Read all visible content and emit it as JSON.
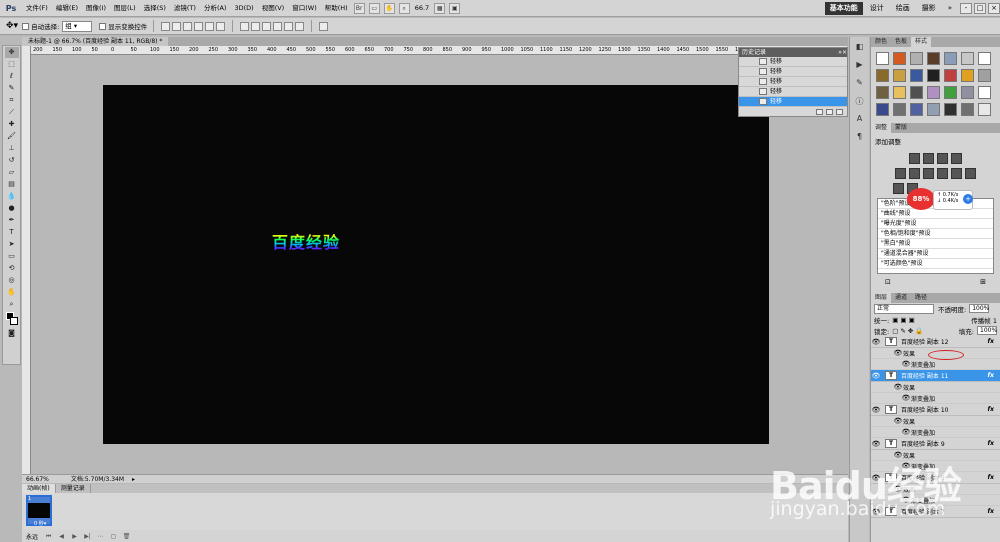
{
  "menubar": {
    "logo": "Ps",
    "items": [
      "文件(F)",
      "编辑(E)",
      "图像(I)",
      "图层(L)",
      "选择(S)",
      "滤镜(T)",
      "分析(A)",
      "3D(D)",
      "视图(V)",
      "窗口(W)",
      "帮助(H)"
    ],
    "zoom": "66.7",
    "workspaces": [
      "基本功能",
      "设计",
      "绘画",
      "摄影"
    ],
    "active_workspace": "基本功能",
    "window_controls": [
      "-",
      "□",
      "×"
    ]
  },
  "options": {
    "auto_select_label": "自动选择:",
    "auto_select_value": "组",
    "show_transform_label": "显示变换控件"
  },
  "document": {
    "tab_title": "未标题-1 @ 66.7% (百度经验 副本 11, RGB/8) *",
    "ruler_marks": [
      "200",
      "150",
      "100",
      "50",
      "0",
      "50",
      "100",
      "150",
      "200",
      "250",
      "300",
      "350",
      "400",
      "450",
      "500",
      "550",
      "600",
      "650",
      "700",
      "750",
      "800",
      "850",
      "900",
      "950",
      "1000",
      "1050",
      "1100",
      "1150",
      "1200",
      "1250",
      "1300",
      "1350",
      "1400",
      "1450",
      "1500",
      "1550",
      "1600",
      "1650",
      "1700",
      "1750",
      "1800"
    ],
    "canvas_text": "百度经验",
    "status_zoom": "66.67%",
    "status_doc": "文档:5.70M/3.34M"
  },
  "timeline": {
    "tabs": [
      "动画(帧)",
      "测量记录"
    ],
    "frame_number": "1",
    "frame_time": "0 秒▾",
    "loop": "永远"
  },
  "history": {
    "title": "历史记录",
    "items": [
      "轻移",
      "轻移",
      "轻移",
      "轻移",
      "轻移"
    ],
    "selected_index": 4
  },
  "styles_panel": {
    "tabs": [
      "颜色",
      "色板",
      "样式"
    ],
    "active_tab": "样式",
    "swatches": [
      "#ffffff",
      "#d45a1f",
      "#b0b0b0",
      "#5a3e2a",
      "#8a9cb8",
      "#c7c7c7",
      "#ffffff",
      "#8a6a2a",
      "#c9a040",
      "#3a5aa0",
      "#202020",
      "#c04040",
      "#e0a020",
      "#a0a0a0",
      "#6e6040",
      "#e8c060",
      "#505050",
      "#b090c0",
      "#40a040",
      "#9090a0",
      "#ffffff",
      "#3a4a8a",
      "#707070",
      "#5060a0",
      "#90a0b0",
      "#303030",
      "#707070",
      "#e8e8e8"
    ]
  },
  "adjustments": {
    "tabs": [
      "调整",
      "蒙版"
    ],
    "title": "添加调整",
    "presets": [
      "\"色阶\"预设",
      "\"曲线\"预设",
      "\"曝光度\"预设",
      "\"色相/饱和度\"预设",
      "\"黑白\"预设",
      "\"通道混合器\"预设",
      "\"可选颜色\"预设"
    ]
  },
  "net_widget": {
    "percent": "88%",
    "up": "0.7K/s",
    "down": "0.4K/s"
  },
  "layers": {
    "tabs": [
      "图层",
      "通道",
      "路径"
    ],
    "blend_mode": "正常",
    "opacity_label": "不透明度:",
    "opacity": "100%",
    "unify_label": "统一:",
    "propagate_label": "传播帧 1",
    "lock_label": "锁定:",
    "fill_label": "填充:",
    "fill": "100%",
    "items": [
      {
        "name": "百度经验 副本 12",
        "effect": "效果",
        "sub": "渐变叠加"
      },
      {
        "name": "百度经验 副本 11",
        "effect": "效果",
        "sub": "渐变叠加"
      },
      {
        "name": "百度经验 副本 10",
        "effect": "效果",
        "sub": "渐变叠加"
      },
      {
        "name": "百度经验 副本 9",
        "effect": "效果",
        "sub": "渐变叠加"
      },
      {
        "name": "百度经验 副本 8",
        "effect": "效果",
        "sub": "渐变叠加"
      },
      {
        "name": "百度经验 副本 7",
        "effect": "",
        "sub": ""
      }
    ],
    "thumb_letter": "T",
    "fx": "fx"
  },
  "watermark": {
    "brand": "Baidu经验",
    "url": "jingyan.baidu.com"
  }
}
